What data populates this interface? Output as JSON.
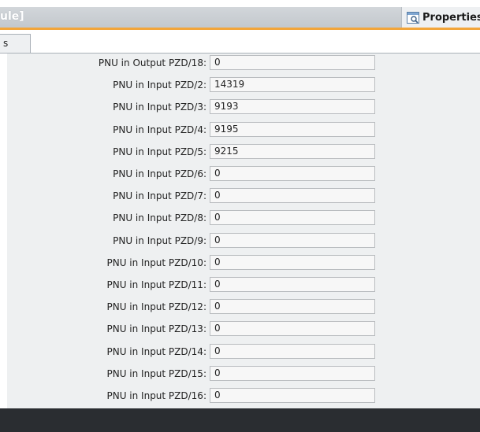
{
  "window": {
    "title": "ule]",
    "properties_tab_label": "Properties"
  },
  "tabs": [
    {
      "label": "s"
    }
  ],
  "parameters": [
    {
      "label": "PNU in Output PZD/18:",
      "value": "0"
    },
    {
      "label": "PNU in Input PZD/2:",
      "value": "14319"
    },
    {
      "label": "PNU in Input PZD/3:",
      "value": "9193"
    },
    {
      "label": "PNU in Input PZD/4:",
      "value": "9195"
    },
    {
      "label": "PNU in Input PZD/5:",
      "value": "9215"
    },
    {
      "label": "PNU in Input PZD/6:",
      "value": "0"
    },
    {
      "label": "PNU in Input PZD/7:",
      "value": "0"
    },
    {
      "label": "PNU in Input PZD/8:",
      "value": "0"
    },
    {
      "label": "PNU in Input PZD/9:",
      "value": "0"
    },
    {
      "label": "PNU in Input PZD/10:",
      "value": "0"
    },
    {
      "label": "PNU in Input PZD/11:",
      "value": "0"
    },
    {
      "label": "PNU in Input PZD/12:",
      "value": "0"
    },
    {
      "label": "PNU in Input PZD/13:",
      "value": "0"
    },
    {
      "label": "PNU in Input PZD/14:",
      "value": "0"
    },
    {
      "label": "PNU in Input PZD/15:",
      "value": "0"
    },
    {
      "label": "PNU in Input PZD/16:",
      "value": "0"
    }
  ]
}
